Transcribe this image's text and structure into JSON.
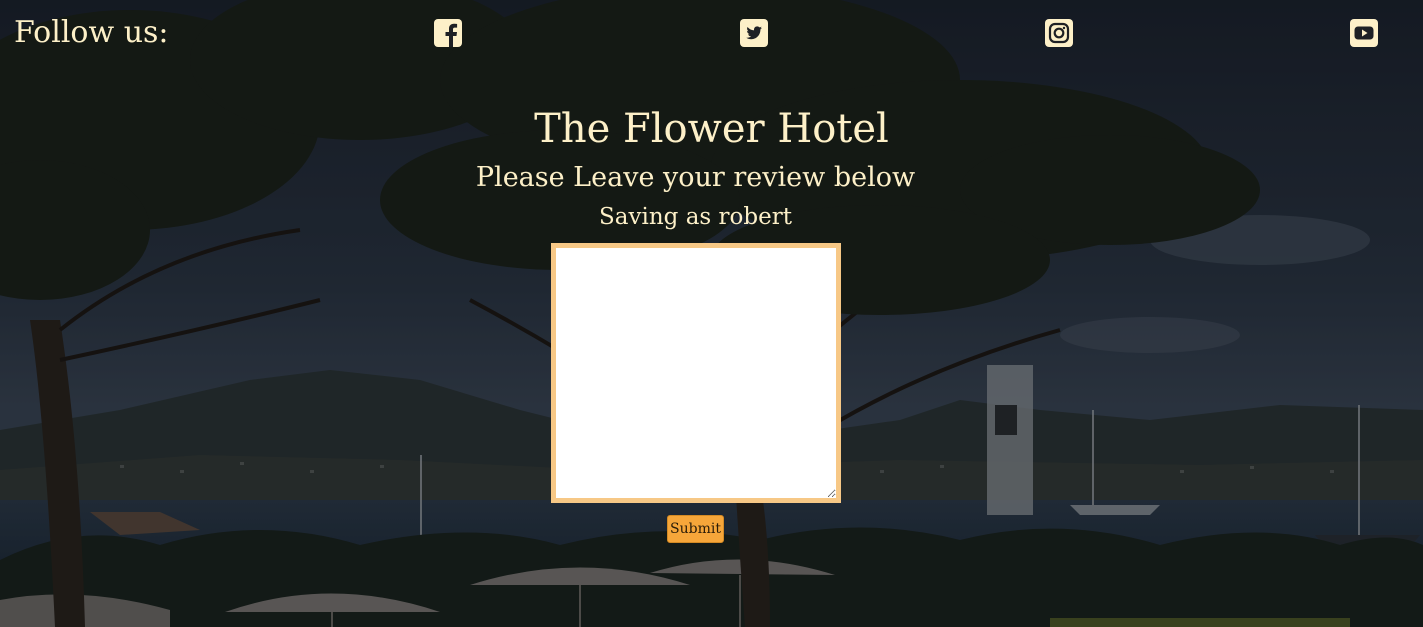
{
  "header": {
    "follow_label": "Follow us:",
    "social": [
      {
        "icon": "facebook-icon",
        "color": "#fdf0c8"
      },
      {
        "icon": "twitter-icon",
        "color": "#fdf0c8"
      },
      {
        "icon": "instagram-icon",
        "color": "#fdf0c8"
      },
      {
        "icon": "youtube-icon",
        "color": "#fdf0c8"
      }
    ]
  },
  "main": {
    "title": "The Flower Hotel",
    "subtitle": "Please Leave your review below",
    "saving_text": "Saving as robert",
    "review_value": "",
    "submit_label": "Submit"
  },
  "colors": {
    "text": "#fdf0c8",
    "textarea_border": "#f7c886",
    "button_bg": "#f6a63a"
  }
}
